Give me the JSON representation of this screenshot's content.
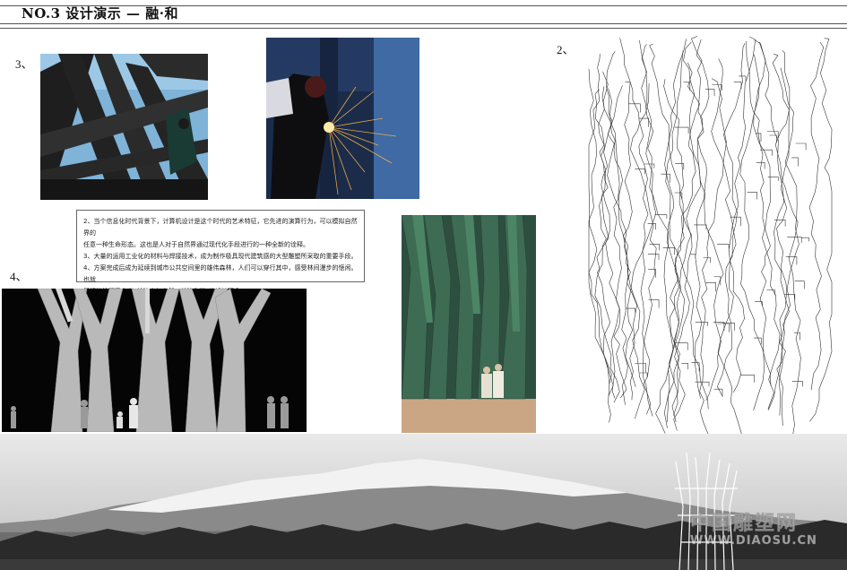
{
  "header": {
    "title": "NO.3  设计演示  — 融·和"
  },
  "labels": {
    "fig2": "2、",
    "fig3": "3、",
    "fig4": "4、"
  },
  "description": {
    "lines": [
      "2、当个信息化时代背景下，计算机设计是这个时代的艺术特征，它先进的演算行为，可以模拟自然界的",
      "任意一种生命形态。这也是人对于自然界通过现代化手段进行的一种全新的诠释。",
      "3、大量的运用工业化的材料与焊接技术，成为制作极具现代建筑感的大型雕塑所采取的重要手段。",
      "4、方案完成后成为延续到城市公共空间里的雄伟森林，人们可以穿行其中，感受林间漫步的惬闲。也就",
      "最好的诠释了作者“关注人与自然，关注和谐”的设计理念。"
    ]
  },
  "watermark": {
    "site_cn": "中国雕塑网",
    "url": "WWW.DIAOSU.CN"
  },
  "colors": {
    "rule": "#555555",
    "accent_green": "#2f5a45",
    "sky_blue": "#6fa0d0"
  },
  "images": [
    {
      "name": "steel-structure-photo"
    },
    {
      "name": "welding-photo"
    },
    {
      "name": "wireframe-forest-drawing"
    },
    {
      "name": "white-tree-sculpture-render"
    },
    {
      "name": "green-tree-sculpture-render"
    },
    {
      "name": "mountain-panorama-photo"
    }
  ]
}
